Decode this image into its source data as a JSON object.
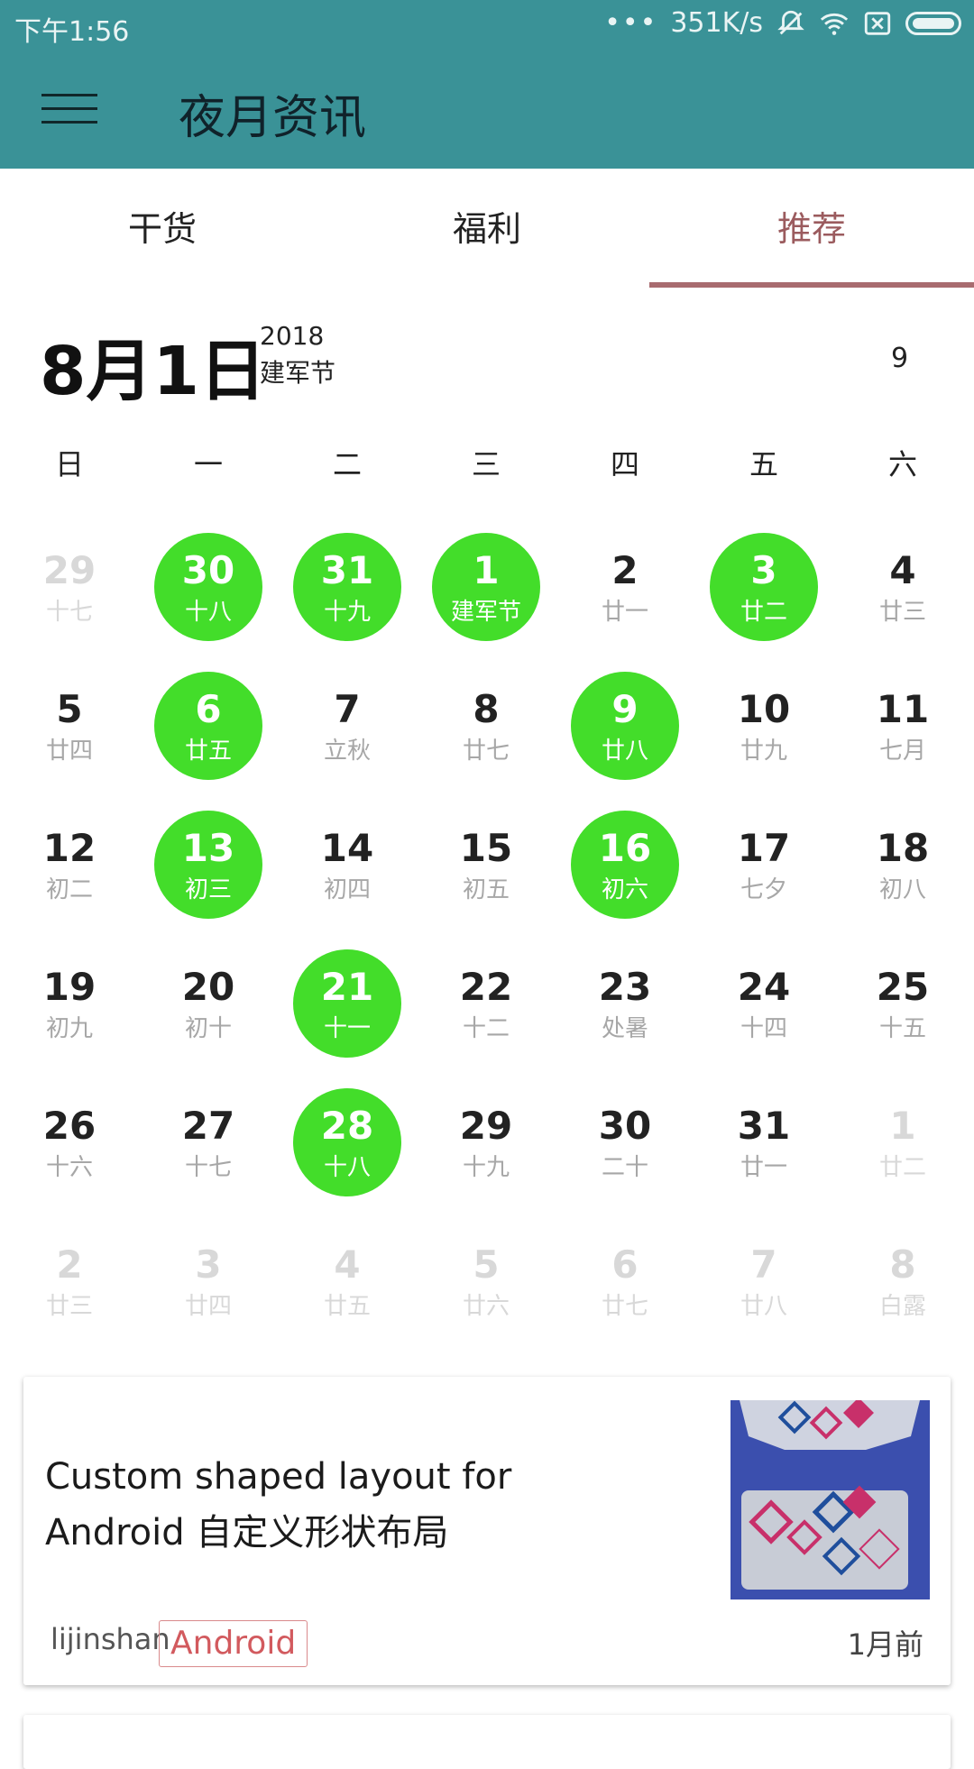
{
  "status_bar": {
    "time": "下午1:56",
    "dots": "•••",
    "speed": "351K/s"
  },
  "app_bar": {
    "title": "夜月资讯"
  },
  "tabs": [
    {
      "label": "干货"
    },
    {
      "label": "福利"
    },
    {
      "label": "推荐"
    }
  ],
  "date_header": {
    "date": "8月1日",
    "year": "2018",
    "festival": "建军节",
    "today": "9"
  },
  "week_days": [
    "日",
    "一",
    "二",
    "三",
    "四",
    "五",
    "六"
  ],
  "calendar": [
    {
      "num": "29",
      "lunar": "十七",
      "other": true
    },
    {
      "num": "30",
      "lunar": "十八",
      "marked": true
    },
    {
      "num": "31",
      "lunar": "十九",
      "marked": true
    },
    {
      "num": "1",
      "lunar": "建军节",
      "marked": true
    },
    {
      "num": "2",
      "lunar": "廿一"
    },
    {
      "num": "3",
      "lunar": "廿二",
      "marked": true
    },
    {
      "num": "4",
      "lunar": "廿三"
    },
    {
      "num": "5",
      "lunar": "廿四"
    },
    {
      "num": "6",
      "lunar": "廿五",
      "marked": true
    },
    {
      "num": "7",
      "lunar": "立秋"
    },
    {
      "num": "8",
      "lunar": "廿七"
    },
    {
      "num": "9",
      "lunar": "廿八",
      "marked": true
    },
    {
      "num": "10",
      "lunar": "廿九"
    },
    {
      "num": "11",
      "lunar": "七月"
    },
    {
      "num": "12",
      "lunar": "初二"
    },
    {
      "num": "13",
      "lunar": "初三",
      "marked": true
    },
    {
      "num": "14",
      "lunar": "初四"
    },
    {
      "num": "15",
      "lunar": "初五"
    },
    {
      "num": "16",
      "lunar": "初六",
      "marked": true
    },
    {
      "num": "17",
      "lunar": "七夕"
    },
    {
      "num": "18",
      "lunar": "初八"
    },
    {
      "num": "19",
      "lunar": "初九"
    },
    {
      "num": "20",
      "lunar": "初十"
    },
    {
      "num": "21",
      "lunar": "十一",
      "marked": true
    },
    {
      "num": "22",
      "lunar": "十二"
    },
    {
      "num": "23",
      "lunar": "处暑"
    },
    {
      "num": "24",
      "lunar": "十四"
    },
    {
      "num": "25",
      "lunar": "十五"
    },
    {
      "num": "26",
      "lunar": "十六"
    },
    {
      "num": "27",
      "lunar": "十七"
    },
    {
      "num": "28",
      "lunar": "十八",
      "marked": true
    },
    {
      "num": "29",
      "lunar": "十九"
    },
    {
      "num": "30",
      "lunar": "二十"
    },
    {
      "num": "31",
      "lunar": "廿一"
    },
    {
      "num": "1",
      "lunar": "廿二",
      "other": true
    },
    {
      "num": "2",
      "lunar": "廿三",
      "other": true
    },
    {
      "num": "3",
      "lunar": "廿四",
      "other": true
    },
    {
      "num": "4",
      "lunar": "廿五",
      "other": true
    },
    {
      "num": "5",
      "lunar": "廿六",
      "other": true
    },
    {
      "num": "6",
      "lunar": "廿七",
      "other": true
    },
    {
      "num": "7",
      "lunar": "廿八",
      "other": true
    },
    {
      "num": "8",
      "lunar": "白露",
      "other": true
    }
  ],
  "article": {
    "title": "Custom shaped layout for Android 自定义形状布局",
    "author": "lijinshan",
    "tag": "Android",
    "time_ago": "1月前"
  },
  "colors": {
    "toolbar": "#3a9297",
    "marked_day": "#43dd2a",
    "active_tab": "#9b5b5e"
  }
}
